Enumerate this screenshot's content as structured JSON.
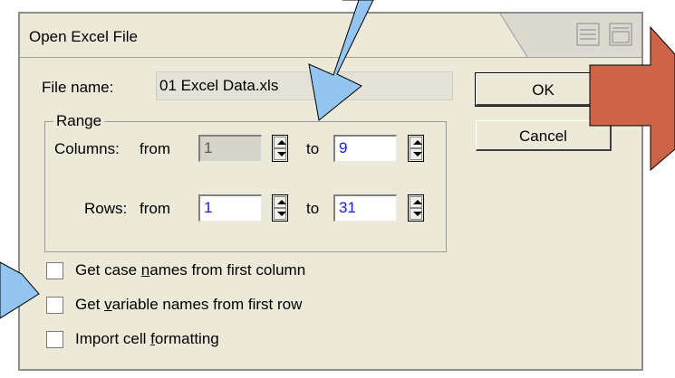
{
  "dialog": {
    "title": "Open Excel File",
    "file_name_label": "File name:",
    "file_name_value": "01 Excel Data.xls",
    "range": {
      "legend": "Range",
      "columns_label": "Columns:",
      "rows_label": "Rows:",
      "from_label": "from",
      "to_label": "to",
      "columns_from": "1",
      "columns_to": "9",
      "rows_from": "1",
      "rows_to": "31"
    },
    "buttons": {
      "ok": "OK",
      "cancel": "Cancel"
    },
    "checkboxes": [
      {
        "prefix": "Get case ",
        "accel": "n",
        "suffix": "ames from first column",
        "checked": false
      },
      {
        "prefix": "Get ",
        "accel": "v",
        "suffix": "ariable names from first row",
        "checked": false
      },
      {
        "prefix": "Import cell ",
        "accel": "f",
        "suffix": "ormatting",
        "checked": false
      }
    ]
  },
  "colors": {
    "dialog_bg": "#ece9d8",
    "value_text": "#1a1ae8",
    "callout_arrow_blue": "#93c5f0",
    "callout_arrow_red": "#cd6448"
  },
  "icons": [
    "window-tile-icon",
    "window-restore-icon",
    "spin-up-icon",
    "spin-down-icon"
  ]
}
